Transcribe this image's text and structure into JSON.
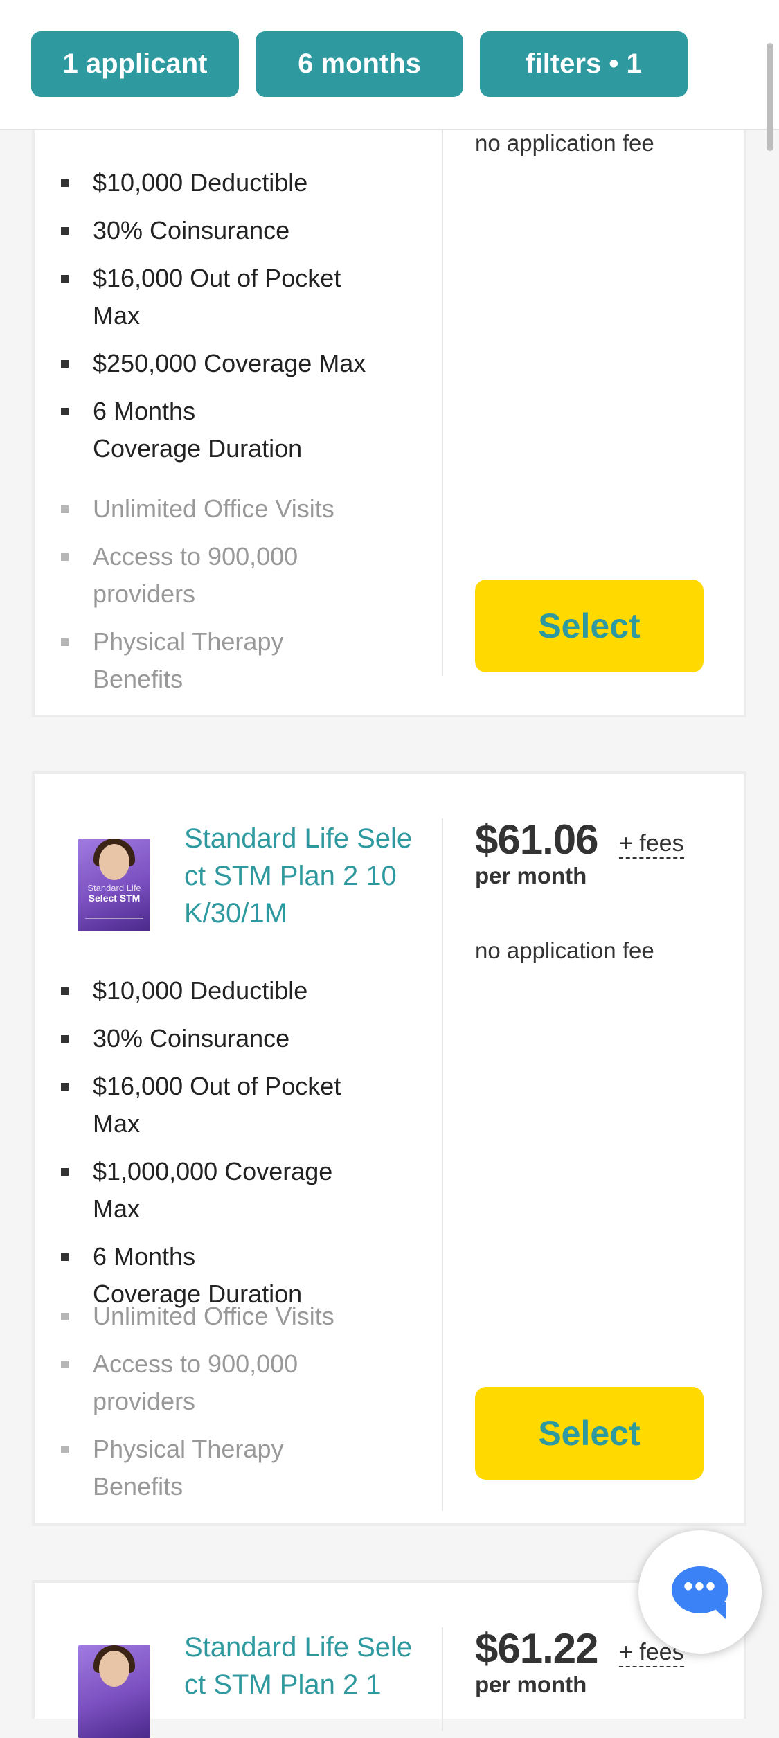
{
  "filters": {
    "applicants": "1 applicant",
    "duration": "6 months",
    "filters": "filters • 1"
  },
  "card1": {
    "application_fee": "no application fee",
    "features": [
      "$10,000 Deductible",
      "30% Coinsurance",
      "$16,000 Out of Pocket Max",
      "$250,000 Coverage Max",
      "6 Months\nCoverage Duration"
    ],
    "extras": [
      "Unlimited Office Visits",
      "Access to 900,000 providers",
      "Physical Therapy Benefits"
    ],
    "select_label": "Select"
  },
  "card2": {
    "title": "Standard Life Select STM Plan 2 10K/30/1M",
    "thumb_text1": "Standard Life",
    "thumb_text2": "Select STM",
    "price": "$61.06",
    "fees": "+ fees",
    "per_month": "per month",
    "application_fee": "no application fee",
    "features": [
      "$10,000 Deductible",
      "30% Coinsurance",
      "$16,000 Out of Pocket Max",
      "$1,000,000 Coverage Max",
      "6 Months\nCoverage Duration"
    ],
    "extras": [
      "Unlimited Office Visits",
      "Access to 900,000 providers",
      "Physical Therapy Benefits"
    ],
    "select_label": "Select"
  },
  "card3": {
    "title": "Standard Life Select STM Plan 2 1",
    "price": "$61.22",
    "fees": "+ fees",
    "per_month": "per month"
  },
  "colors": {
    "teal": "#2e9aa0",
    "yellow": "#ffd900",
    "chat": "#3b82f6"
  }
}
